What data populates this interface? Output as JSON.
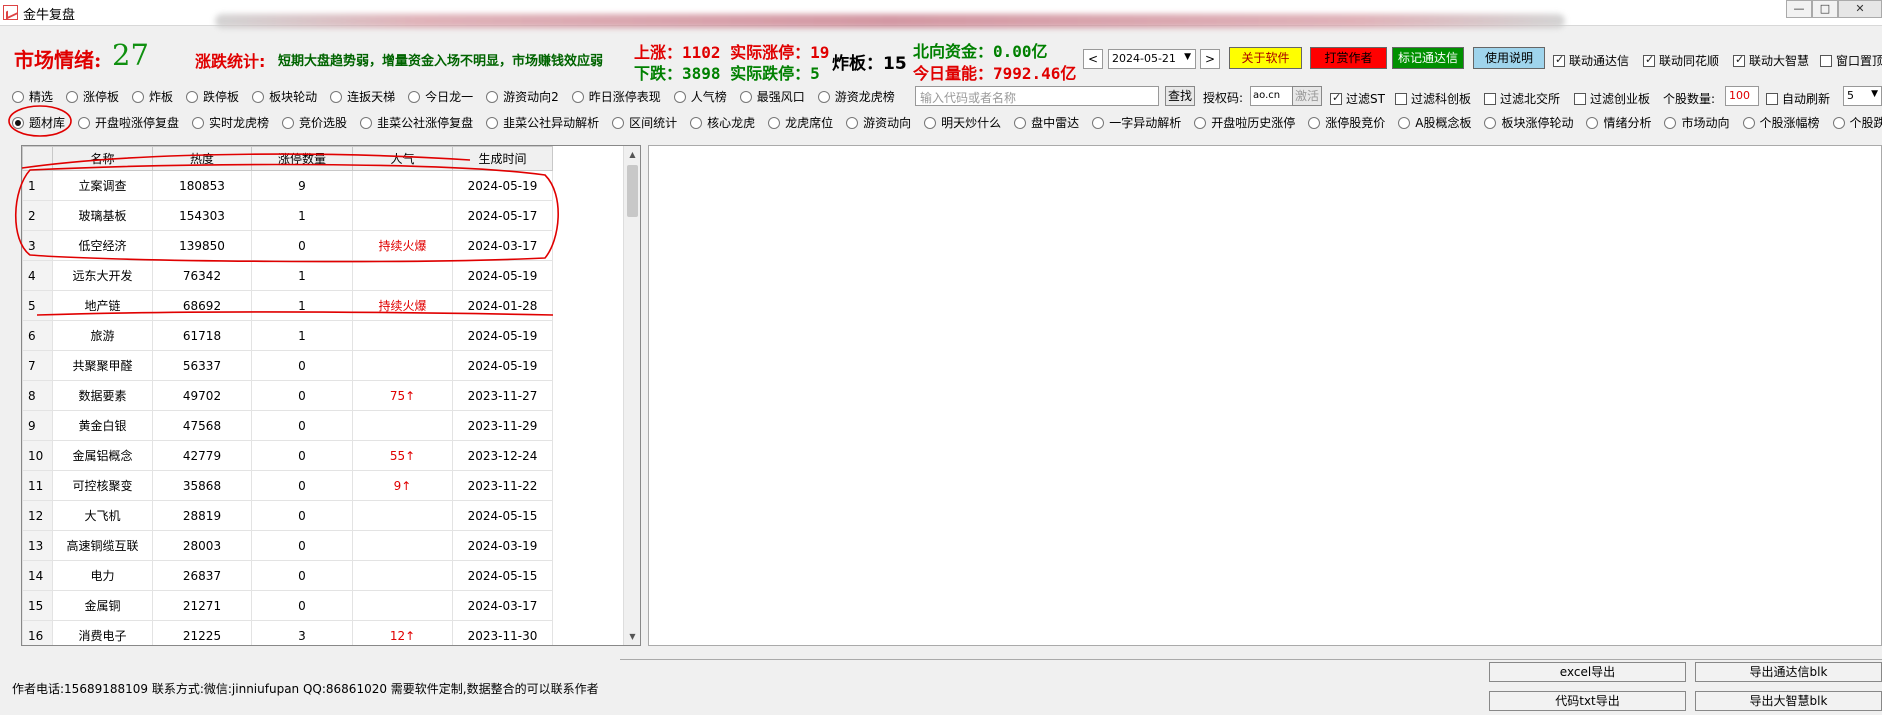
{
  "window": {
    "title": "金牛复盘"
  },
  "window_controls": {
    "minimize": "—",
    "maximize": "□",
    "close": "✕"
  },
  "stats": {
    "mood_label": "市场情绪:",
    "mood_value": "27",
    "stats_label": "涨跌统计:",
    "stats_text": "短期大盘趋势弱，增量资金入场不明显，市场赚钱效应弱",
    "up_line": "上涨：1102 实际涨停：19",
    "down_line": "下跌：3898 实际跌停：5",
    "zhaban": "炸板：15",
    "north_funds": "北向资金：0.00亿",
    "today_volume": "今日量能：7992.46亿"
  },
  "toolbar": {
    "prev": "<",
    "next": ">",
    "date": "2024-05-21",
    "date_arrow": "▼",
    "about": "关于软件",
    "tip": "打赏作者",
    "mark": "标记通达信",
    "help": "使用说明",
    "checks": [
      {
        "label": "联动通达信",
        "checked": true
      },
      {
        "label": "联动同花顺",
        "checked": true
      },
      {
        "label": "联动大智慧",
        "checked": true
      },
      {
        "label": "窗口置顶",
        "checked": false
      }
    ]
  },
  "radios_row1": [
    "精选",
    "涨停板",
    "炸板",
    "跌停板",
    "板块轮动",
    "连扳天梯",
    "今日龙一",
    "游资动向2",
    "昨日涨停表现",
    "人气榜",
    "最强风口",
    "游资龙虎榜"
  ],
  "search": {
    "placeholder": "输入代码或者名称",
    "button": "查找",
    "auth_label": "授权码:",
    "auth_value": "ao.cn",
    "activate": "激活"
  },
  "filters": [
    {
      "label": "过滤ST",
      "checked": true
    },
    {
      "label": "过滤科创板",
      "checked": false
    },
    {
      "label": "过滤北交所",
      "checked": false
    },
    {
      "label": "过滤创业板",
      "checked": false
    }
  ],
  "stock_count": {
    "label": "个股数量:",
    "value": "100"
  },
  "auto_refresh": {
    "label": "自动刷新",
    "checked": false,
    "interval": "5"
  },
  "radios_row2": [
    "题材库",
    "开盘啦涨停复盘",
    "实时龙虎榜",
    "竞价选股",
    "韭菜公社涨停复盘",
    "韭菜公社异动解析",
    "区间统计",
    "核心龙虎",
    "龙虎席位",
    "游资动向",
    "明天炒什么",
    "盘中雷达",
    "一字异动解析",
    "开盘啦历史涨停",
    "涨停股竞价",
    "A股概念板",
    "板块涨停轮动",
    "情绪分析",
    "市场动向",
    "个股涨幅榜",
    "个股跌幅榜"
  ],
  "selected_radio": "题材库",
  "table": {
    "headers": [
      "",
      "名称",
      "热度",
      "涨停数量",
      "人气",
      "生成时间"
    ],
    "rows": [
      [
        "1",
        "立案调查",
        "180853",
        "9",
        "",
        "2024-05-19"
      ],
      [
        "2",
        "玻璃基板",
        "154303",
        "1",
        "",
        "2024-05-17"
      ],
      [
        "3",
        "低空经济",
        "139850",
        "0",
        "持续火爆",
        "2024-03-17"
      ],
      [
        "4",
        "远东大开发",
        "76342",
        "1",
        "",
        "2024-05-19"
      ],
      [
        "5",
        "地产链",
        "68692",
        "1",
        "持续火爆",
        "2024-01-28"
      ],
      [
        "6",
        "旅游",
        "61718",
        "1",
        "",
        "2024-05-19"
      ],
      [
        "7",
        "共聚聚甲醛",
        "56337",
        "0",
        "",
        "2024-05-19"
      ],
      [
        "8",
        "数据要素",
        "49702",
        "0",
        "75↑",
        "2023-11-27"
      ],
      [
        "9",
        "黄金白银",
        "47568",
        "0",
        "",
        "2023-11-29"
      ],
      [
        "10",
        "金属铝概念",
        "42779",
        "0",
        "55↑",
        "2023-12-24"
      ],
      [
        "11",
        "可控核聚变",
        "35868",
        "0",
        "9↑",
        "2023-11-22"
      ],
      [
        "12",
        "大飞机",
        "28819",
        "0",
        "",
        "2024-05-15"
      ],
      [
        "13",
        "高速铜缆互联",
        "28003",
        "0",
        "",
        "2024-03-19"
      ],
      [
        "14",
        "电力",
        "26837",
        "0",
        "",
        "2024-05-15"
      ],
      [
        "15",
        "金属铜",
        "21271",
        "0",
        "",
        "2024-03-17"
      ],
      [
        "16",
        "消费电子",
        "21225",
        "3",
        "12↑",
        "2023-11-30"
      ]
    ]
  },
  "footer": {
    "contact": "作者电话:15689188109 联系方式:微信:jinniufupan QQ:86861020 需要软件定制,数据整合的可以联系作者"
  },
  "bottom_buttons": {
    "excel_export": "excel导出",
    "tdx_export": "导出通达信blk",
    "code_export": "代码txt导出",
    "dzh_export": "导出大智慧blk"
  },
  "colors": {
    "red": "#e00000",
    "green": "#008000",
    "annotation": "#e00000"
  }
}
